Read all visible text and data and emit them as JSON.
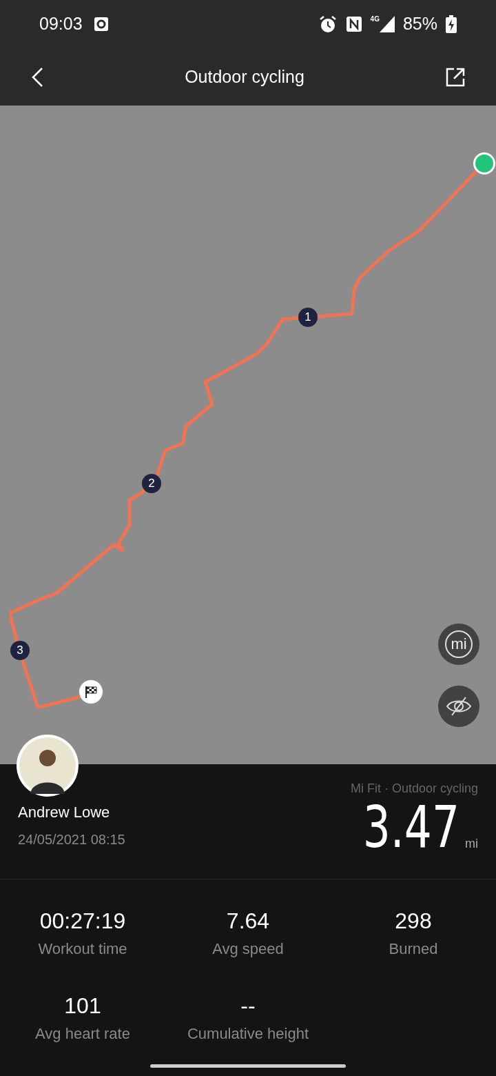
{
  "status_bar": {
    "time": "09:03",
    "network": "4G",
    "battery": "85%"
  },
  "header": {
    "title": "Outdoor cycling"
  },
  "map": {
    "markers": [
      {
        "label": "1"
      },
      {
        "label": "2"
      },
      {
        "label": "3"
      }
    ],
    "unit_button": "mi"
  },
  "summary": {
    "name": "Andrew Lowe",
    "date": "24/05/2021 08:15",
    "source": "Mi Fit · Outdoor cycling",
    "distance": "3.47",
    "unit": "mi"
  },
  "stats": [
    {
      "value": "00:27:19",
      "label": "Workout time"
    },
    {
      "value": "7.64",
      "label": "Avg speed"
    },
    {
      "value": "298",
      "label": "Burned"
    },
    {
      "value": "101",
      "label": "Avg heart rate"
    },
    {
      "value": "--",
      "label": "Cumulative height"
    }
  ]
}
